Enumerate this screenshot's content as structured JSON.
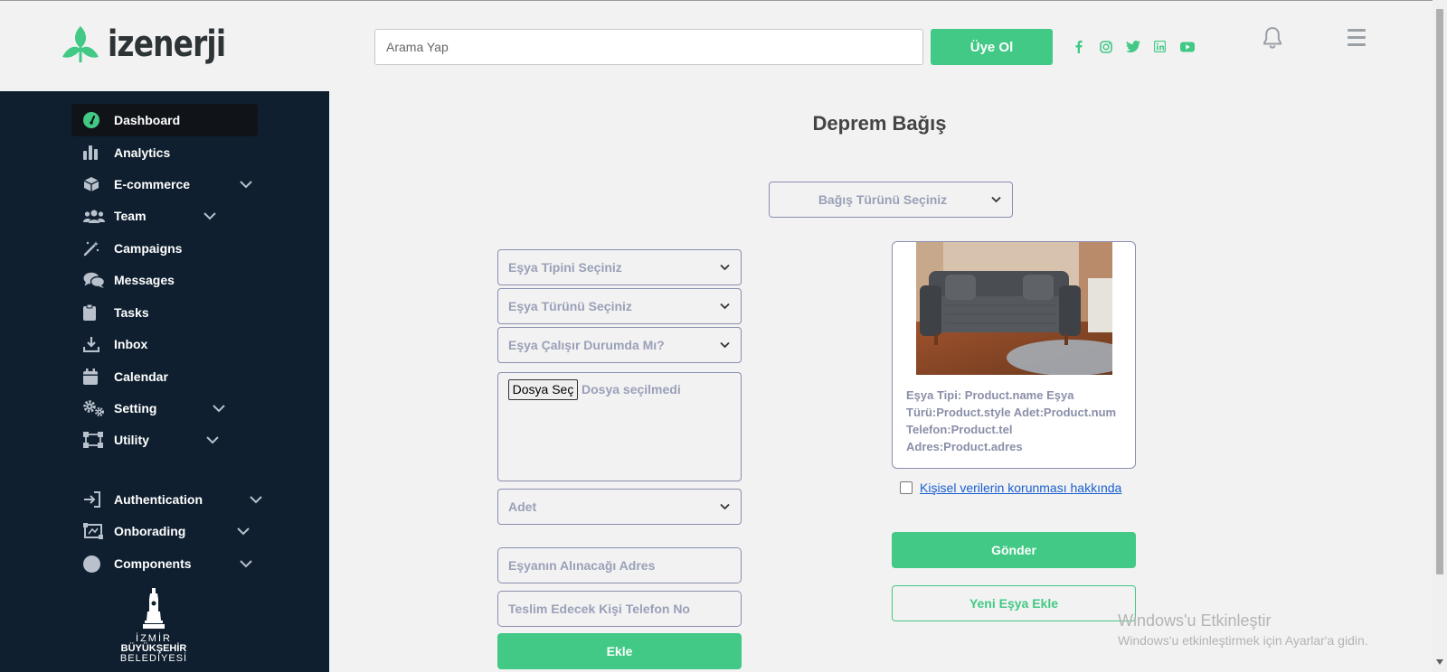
{
  "brand": {
    "name": "izenerji",
    "accent": "#41c985",
    "sidebar_bg": "#0f1f2f"
  },
  "header": {
    "search_placeholder": "Arama Yap",
    "signup_label": "Üye Ol",
    "social": [
      "facebook-icon",
      "instagram-icon",
      "twitter-icon",
      "linkedin-icon",
      "youtube-icon"
    ]
  },
  "sidebar": {
    "items": [
      {
        "label": "Dashboard",
        "icon": "gauge-icon",
        "active": true
      },
      {
        "label": "Analytics",
        "icon": "bar-chart-icon"
      },
      {
        "label": "E-commerce",
        "icon": "box-icon",
        "expandable": true
      },
      {
        "label": "Team",
        "icon": "users-icon",
        "expandable": true
      },
      {
        "label": "Campaigns",
        "icon": "magic-wand-icon"
      },
      {
        "label": "Messages",
        "icon": "chat-icon"
      },
      {
        "label": "Tasks",
        "icon": "clipboard-icon"
      },
      {
        "label": "Inbox",
        "icon": "download-icon"
      },
      {
        "label": "Calendar",
        "icon": "calendar-icon"
      },
      {
        "label": "Setting",
        "icon": "gears-icon",
        "expandable": true
      },
      {
        "label": "Utility",
        "icon": "utility-icon",
        "expandable": true
      },
      {
        "label": "Authentication",
        "icon": "sign-in-icon",
        "expandable": true
      },
      {
        "label": "Onborading",
        "icon": "onboarding-icon",
        "expandable": true
      },
      {
        "label": "Components",
        "icon": "circle-icon",
        "expandable": true
      }
    ],
    "footer_logo": {
      "line1": "İZMİR",
      "line2": "BÜYÜKŞEHİR",
      "line3": "BELEDİYESİ"
    }
  },
  "main": {
    "title": "Deprem Bağış",
    "donation_type_select": "Bağış Türünü Seçiniz",
    "item_type_select": "Eşya Tipini Seçiniz",
    "item_kind_select": "Eşya Türünü Seçiniz",
    "item_working_select": "Eşya Çalışır Durumda Mı?",
    "file_button": "Dosya Seç",
    "file_status": "Dosya seçilmedi",
    "quantity_select": "Adet",
    "address_placeholder": "Eşyanın Alınacağı Adres",
    "phone_placeholder": "Teslim Edecek Kişi Telefon No",
    "add_button": "Ekle",
    "card": {
      "line1": "Eşya Tipi: Product.name Eşya",
      "line2": "Türü:Product.style Adet:Product.num",
      "line3": "Telefon:Product.tel",
      "line4": "Adres:Product.adres"
    },
    "consent_link": "Kişisel verilerin korunması hakkında",
    "submit_button": "Gönder",
    "new_item_button": "Yeni Eşya Ekle"
  },
  "watermark": {
    "line1": "Windows'u Etkinleştir",
    "line2": "Windows'u etkinleştirmek için Ayarlar'a gidin."
  }
}
